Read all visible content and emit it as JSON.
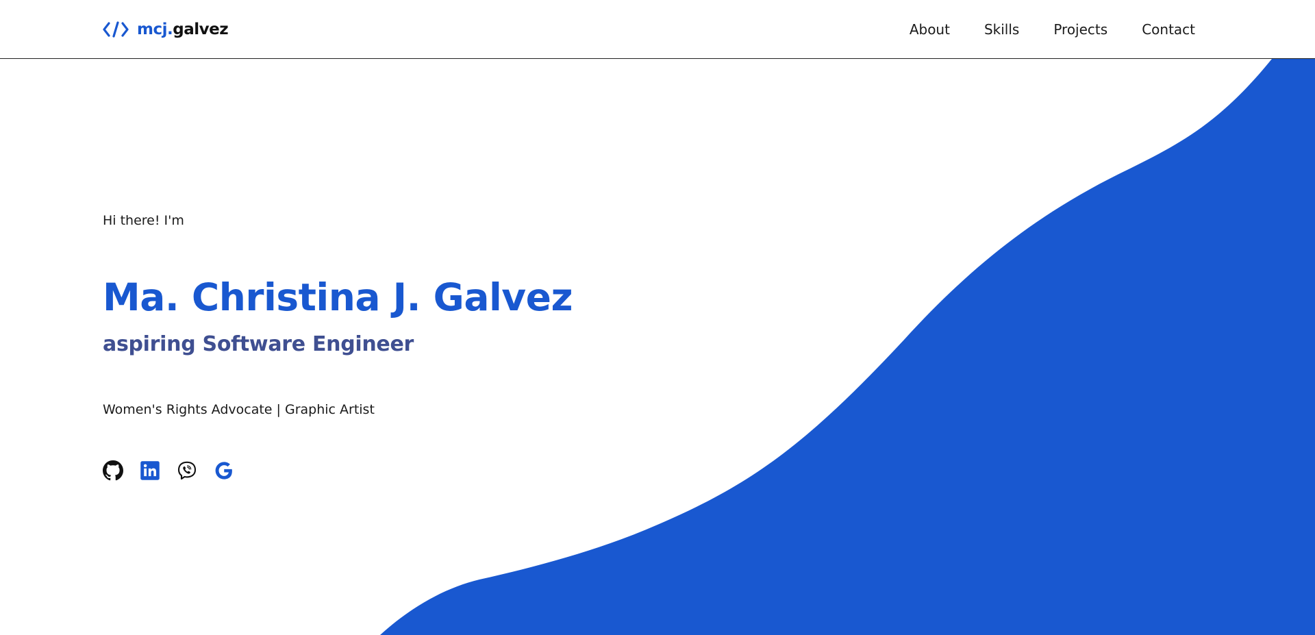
{
  "brand": {
    "prefix": "mcj.",
    "name": "galvez",
    "icon": "code-brackets-icon"
  },
  "nav": {
    "items": [
      {
        "label": "About"
      },
      {
        "label": "Skills"
      },
      {
        "label": "Projects"
      },
      {
        "label": "Contact"
      }
    ]
  },
  "hero": {
    "greeting": "Hi there! I'm",
    "name": "Ma. Christina J. Galvez",
    "role": "aspiring Software Engineer",
    "tagline": "Women's Rights Advocate | Graphic Artist"
  },
  "socials": [
    {
      "icon": "github-icon"
    },
    {
      "icon": "linkedin-icon"
    },
    {
      "icon": "viber-icon"
    },
    {
      "icon": "google-icon"
    }
  ],
  "colors": {
    "accent": "#1958d0",
    "role_text": "#3f4f91",
    "text": "#1a1a1a",
    "background": "#ffffff"
  }
}
